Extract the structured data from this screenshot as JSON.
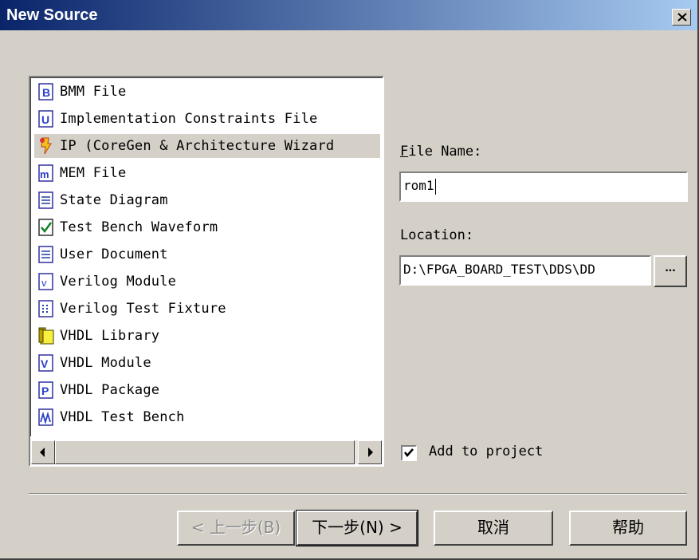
{
  "window": {
    "title": "New Source",
    "close_glyph": "✕"
  },
  "source_types": [
    {
      "label": "BMM File",
      "icon": "bmm-file-icon"
    },
    {
      "label": "Implementation Constraints File",
      "icon": "constraints-file-icon"
    },
    {
      "label": "IP (CoreGen & Architecture Wizard",
      "icon": "ip-wizard-icon",
      "selected": true
    },
    {
      "label": "MEM File",
      "icon": "mem-file-icon"
    },
    {
      "label": "State Diagram",
      "icon": "state-diagram-icon"
    },
    {
      "label": "Test Bench Waveform",
      "icon": "test-bench-waveform-icon"
    },
    {
      "label": "User Document",
      "icon": "user-document-icon"
    },
    {
      "label": "Verilog Module",
      "icon": "verilog-module-icon"
    },
    {
      "label": "Verilog Test Fixture",
      "icon": "verilog-test-fixture-icon"
    },
    {
      "label": "VHDL Library",
      "icon": "vhdl-library-icon"
    },
    {
      "label": "VHDL Module",
      "icon": "vhdl-module-icon"
    },
    {
      "label": "VHDL Package",
      "icon": "vhdl-package-icon"
    },
    {
      "label": "VHDL Test Bench",
      "icon": "vhdl-test-bench-icon"
    }
  ],
  "file_name": {
    "label": "File Name:",
    "mnemonic": "F",
    "value": "rom1"
  },
  "location": {
    "label": "Location:",
    "value": "D:\\FPGA_BOARD_TEST\\DDS\\DD",
    "browse_label": "..."
  },
  "add_to_project": {
    "label": "Add to project",
    "checked": true
  },
  "buttons": {
    "back": "< 上一步(B)",
    "next": "下一步(N) >",
    "cancel": "取消",
    "help": "帮助"
  },
  "colors": {
    "title_start": "#0a246a",
    "title_end": "#a6caf0",
    "face": "#d4d0c8"
  }
}
